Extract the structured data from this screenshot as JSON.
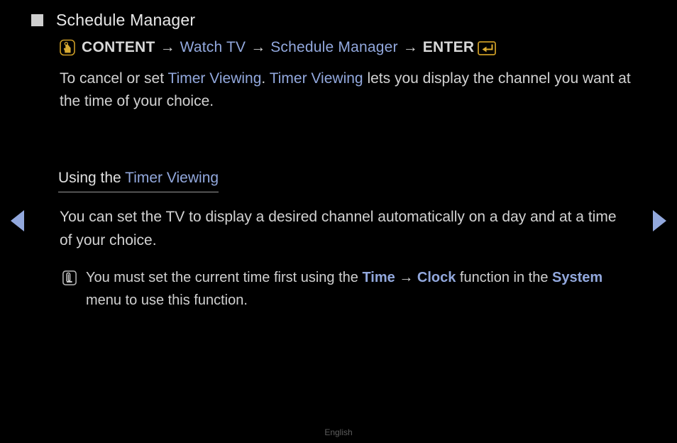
{
  "page": {
    "title": "Schedule Manager",
    "footer_language": "English"
  },
  "breadcrumb": {
    "content_icon": "content-icon",
    "items": [
      {
        "label": "CONTENT",
        "style": "plain"
      },
      {
        "label": "Watch TV",
        "style": "link"
      },
      {
        "label": "Schedule Manager",
        "style": "link"
      },
      {
        "label": "ENTER",
        "style": "plain"
      }
    ],
    "separator": "→",
    "enter_icon": "enter-icon"
  },
  "intro": {
    "seg1": "To cancel or set ",
    "seg2": "Timer Viewing",
    "seg3": ". ",
    "seg4": "Timer Viewing",
    "seg5": " lets you display the channel you want at the time of your choice."
  },
  "section": {
    "heading_plain": "Using the ",
    "heading_link": "Timer Viewing",
    "body": "You can set the TV to display a desired channel automatically on a day and at a time of your choice."
  },
  "note": {
    "icon": "note-icon",
    "seg1": "You must set the current time first using the ",
    "seg2": "Time",
    "seg3": " → ",
    "seg4": "Clock",
    "seg5": " function in the ",
    "seg6": "System",
    "seg7": " menu to use this function."
  },
  "nav": {
    "prev": "previous-page-arrow",
    "next": "next-page-arrow"
  },
  "colors": {
    "background": "#000000",
    "body_text": "#d2d2d2",
    "link_blue": "#92a8dd",
    "gold": "#c99a25",
    "footer_text": "#5d5d5d"
  }
}
